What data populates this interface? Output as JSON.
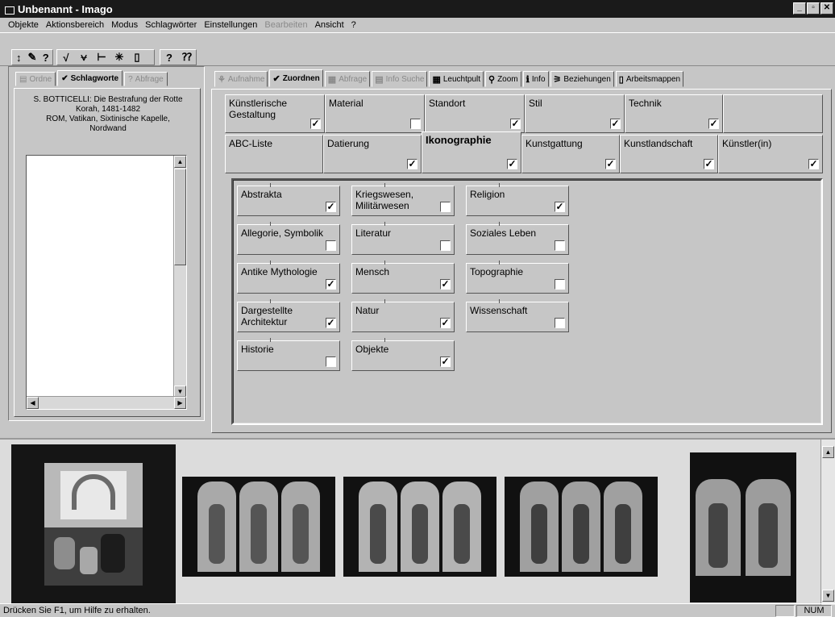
{
  "window": {
    "title": "Unbenannt - Imago",
    "controls": [
      "_",
      "▫",
      "✕"
    ]
  },
  "menu": [
    {
      "label": "Objekte",
      "disabled": false
    },
    {
      "label": "Aktionsbereich",
      "disabled": false
    },
    {
      "label": "Modus",
      "disabled": false
    },
    {
      "label": "Schlagwörter",
      "disabled": false
    },
    {
      "label": "Einstellungen",
      "disabled": false
    },
    {
      "label": "Bearbeiten",
      "disabled": true
    },
    {
      "label": "Ansicht",
      "disabled": false
    },
    {
      "label": "?",
      "disabled": false
    }
  ],
  "toolbar": {
    "icons": [
      "select-icon",
      "edit-icon",
      "help-icon",
      "check-icon",
      "multi-check-icon",
      "tree-icon",
      "asterisk-icon",
      "page-icon",
      "question-icon",
      "context-help-icon"
    ]
  },
  "left_tabs": [
    {
      "label": "Ordne",
      "icon": "folder-icon",
      "active": false,
      "disabled": true
    },
    {
      "label": "Schlagworte",
      "icon": "check-icon",
      "active": true,
      "disabled": false
    },
    {
      "label": "Abfrage",
      "icon": "question-icon",
      "active": false,
      "disabled": true
    }
  ],
  "caption": {
    "line1": "S. BOTTICELLI: Die Bestrafung der Rotte",
    "line2": "Korah, 1481-1482",
    "line3": "ROM, Vatikan, Sixtinische Kapelle,",
    "line4": "Nordwand"
  },
  "right_tabs": [
    {
      "label": "Aufnahme",
      "icon": "camera-icon",
      "active": false,
      "disabled": true
    },
    {
      "label": "Zuordnen",
      "icon": "check-icon",
      "active": true,
      "disabled": false
    },
    {
      "label": "Abfrage",
      "icon": "grid-icon",
      "active": false,
      "disabled": true
    },
    {
      "label": "Info Suche",
      "icon": "search-doc-icon",
      "active": false,
      "disabled": true
    },
    {
      "label": "Leuchtpult",
      "icon": "lightbox-icon",
      "active": false,
      "disabled": false
    },
    {
      "label": "Zoom",
      "icon": "magnifier-icon",
      "active": false,
      "disabled": false
    },
    {
      "label": "Info",
      "icon": "info-icon",
      "active": false,
      "disabled": false
    },
    {
      "label": "Beziehungen",
      "icon": "relations-icon",
      "active": false,
      "disabled": false
    },
    {
      "label": "Arbeitsmappen",
      "icon": "book-icon",
      "active": false,
      "disabled": false
    }
  ],
  "category_row1": [
    {
      "label": "Künstlerische Gestaltung",
      "checked": true
    },
    {
      "label": "Material",
      "checked": false
    },
    {
      "label": "Standort",
      "checked": true
    },
    {
      "label": "Stil",
      "checked": true
    },
    {
      "label": "Technik",
      "checked": true
    },
    {
      "label": "",
      "checked": null
    }
  ],
  "category_row2": [
    {
      "label": "ABC-Liste",
      "checked": null,
      "active": false
    },
    {
      "label": "Datierung",
      "checked": true,
      "active": false
    },
    {
      "label": "Ikonographie",
      "checked": true,
      "active": true
    },
    {
      "label": "Kunstgattung",
      "checked": true,
      "active": false
    },
    {
      "label": "Kunstlandschaft",
      "checked": true,
      "active": false
    },
    {
      "label": "Künstler(in)",
      "checked": true,
      "active": false
    }
  ],
  "ikonographie": [
    {
      "label": "Abstrakta",
      "checked": true
    },
    {
      "label": "Kriegswesen, Militärwesen",
      "checked": false
    },
    {
      "label": "Religion",
      "checked": true
    },
    {
      "label": "Allegorie, Symbolik",
      "checked": false
    },
    {
      "label": "Literatur",
      "checked": false
    },
    {
      "label": "Soziales Leben",
      "checked": false
    },
    {
      "label": "Antike Mythologie",
      "checked": true
    },
    {
      "label": "Mensch",
      "checked": true
    },
    {
      "label": "Topographie",
      "checked": false
    },
    {
      "label": "Dargestellte Architektur",
      "checked": true
    },
    {
      "label": "Natur",
      "checked": true
    },
    {
      "label": "Wissenschaft",
      "checked": false
    },
    {
      "label": "Historie",
      "checked": false
    },
    {
      "label": "Objekte",
      "checked": true
    }
  ],
  "status": {
    "text": "Drücken Sie F1, um Hilfe zu erhalten.",
    "indicator": "NUM"
  },
  "colors": {
    "titlebar": "#1a1a1a",
    "face": "#c6c6c6",
    "filmstrip": "#dcdcdc"
  }
}
